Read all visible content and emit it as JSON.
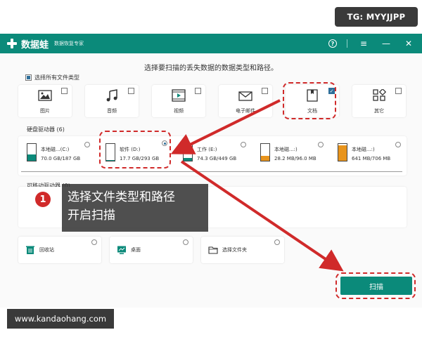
{
  "badge": {
    "text": "TG: MYYJJPP"
  },
  "app": {
    "name": "数据蛙",
    "subtitle": "数据恢复专家",
    "help_symbol": "?",
    "menu_symbol": "≡",
    "minimize_symbol": "—",
    "close_symbol": "✕",
    "brand_color": "#0b8a7a"
  },
  "prompt": "选择要扫描的丢失数据的数据类型和路径。",
  "select_all": {
    "label": "选择所有文件类型"
  },
  "file_types": [
    {
      "label": "图片",
      "checked": false,
      "icon": "image-icon"
    },
    {
      "label": "音频",
      "checked": false,
      "icon": "music-icon"
    },
    {
      "label": "视频",
      "checked": false,
      "icon": "video-icon"
    },
    {
      "label": "电子邮件",
      "checked": false,
      "icon": "mail-icon"
    },
    {
      "label": "文档",
      "checked": true,
      "icon": "document-icon"
    },
    {
      "label": "其它",
      "checked": false,
      "icon": "other-icon"
    }
  ],
  "hard_drives": {
    "title": "硬盘驱动器 (6)",
    "items": [
      {
        "name": "本地磁...(C:)",
        "size": "70.0 GB/187 GB",
        "selected": false,
        "fill": 0.37
      },
      {
        "name": "软件 (D:)",
        "size": "17.7 GB/293 GB",
        "selected": true,
        "fill": 0.06
      },
      {
        "name": "工作 (E:)",
        "size": "74.3 GB/449 GB",
        "selected": false,
        "fill": 0.17
      },
      {
        "name": "本地磁...:)",
        "size": "28.2 MB/96.0 MB",
        "selected": false,
        "fill": 0.29
      },
      {
        "name": "本地磁...:)",
        "size": "641 MB/706 MB",
        "selected": false,
        "fill": 0.91
      }
    ]
  },
  "removable": {
    "title": "可移动驱动器 (0)"
  },
  "locations": [
    {
      "label": "回收站",
      "icon": "recycle-bin-icon"
    },
    {
      "label": "桌面",
      "icon": "desktop-icon"
    },
    {
      "label": "选择文件夹",
      "icon": "folder-icon"
    }
  ],
  "scan_button": {
    "label": "扫描"
  },
  "callout": {
    "step": "1",
    "line1": "选择文件类型和路径",
    "line2": "开启扫描"
  },
  "watermark": {
    "text": "www.kandaohang.com"
  },
  "highlight_color": "#d02a2a"
}
